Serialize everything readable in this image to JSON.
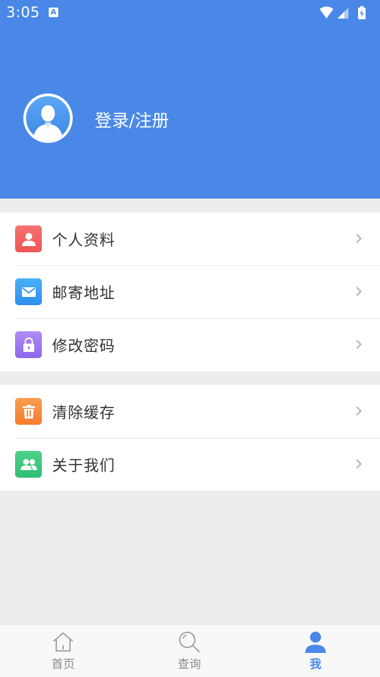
{
  "status_bar": {
    "time": "3:05",
    "notification_icon": "a-icon",
    "icons": [
      "wifi-icon",
      "signal-icon",
      "battery-charging-icon"
    ]
  },
  "header": {
    "avatar_icon": "user-avatar-icon",
    "login_label": "登录/注册"
  },
  "menu": {
    "group1": [
      {
        "label": "个人资料",
        "icon": "person-icon"
      },
      {
        "label": "邮寄地址",
        "icon": "mail-icon"
      },
      {
        "label": "修改密码",
        "icon": "lock-icon"
      }
    ],
    "group2": [
      {
        "label": "清除缓存",
        "icon": "trash-icon"
      },
      {
        "label": "关于我们",
        "icon": "people-icon"
      }
    ]
  },
  "tabbar": {
    "tabs": [
      {
        "label": "首页",
        "icon": "home-icon",
        "active": false
      },
      {
        "label": "查询",
        "icon": "search-icon",
        "active": false
      },
      {
        "label": "我",
        "icon": "person-icon",
        "active": true
      }
    ]
  },
  "colors": {
    "primary": "#4a88e8",
    "background": "#ededed",
    "red": "#ef5454",
    "blue": "#2e8ef0",
    "purple": "#8d68ea",
    "orange": "#f57d2c",
    "green": "#2ebd73"
  }
}
